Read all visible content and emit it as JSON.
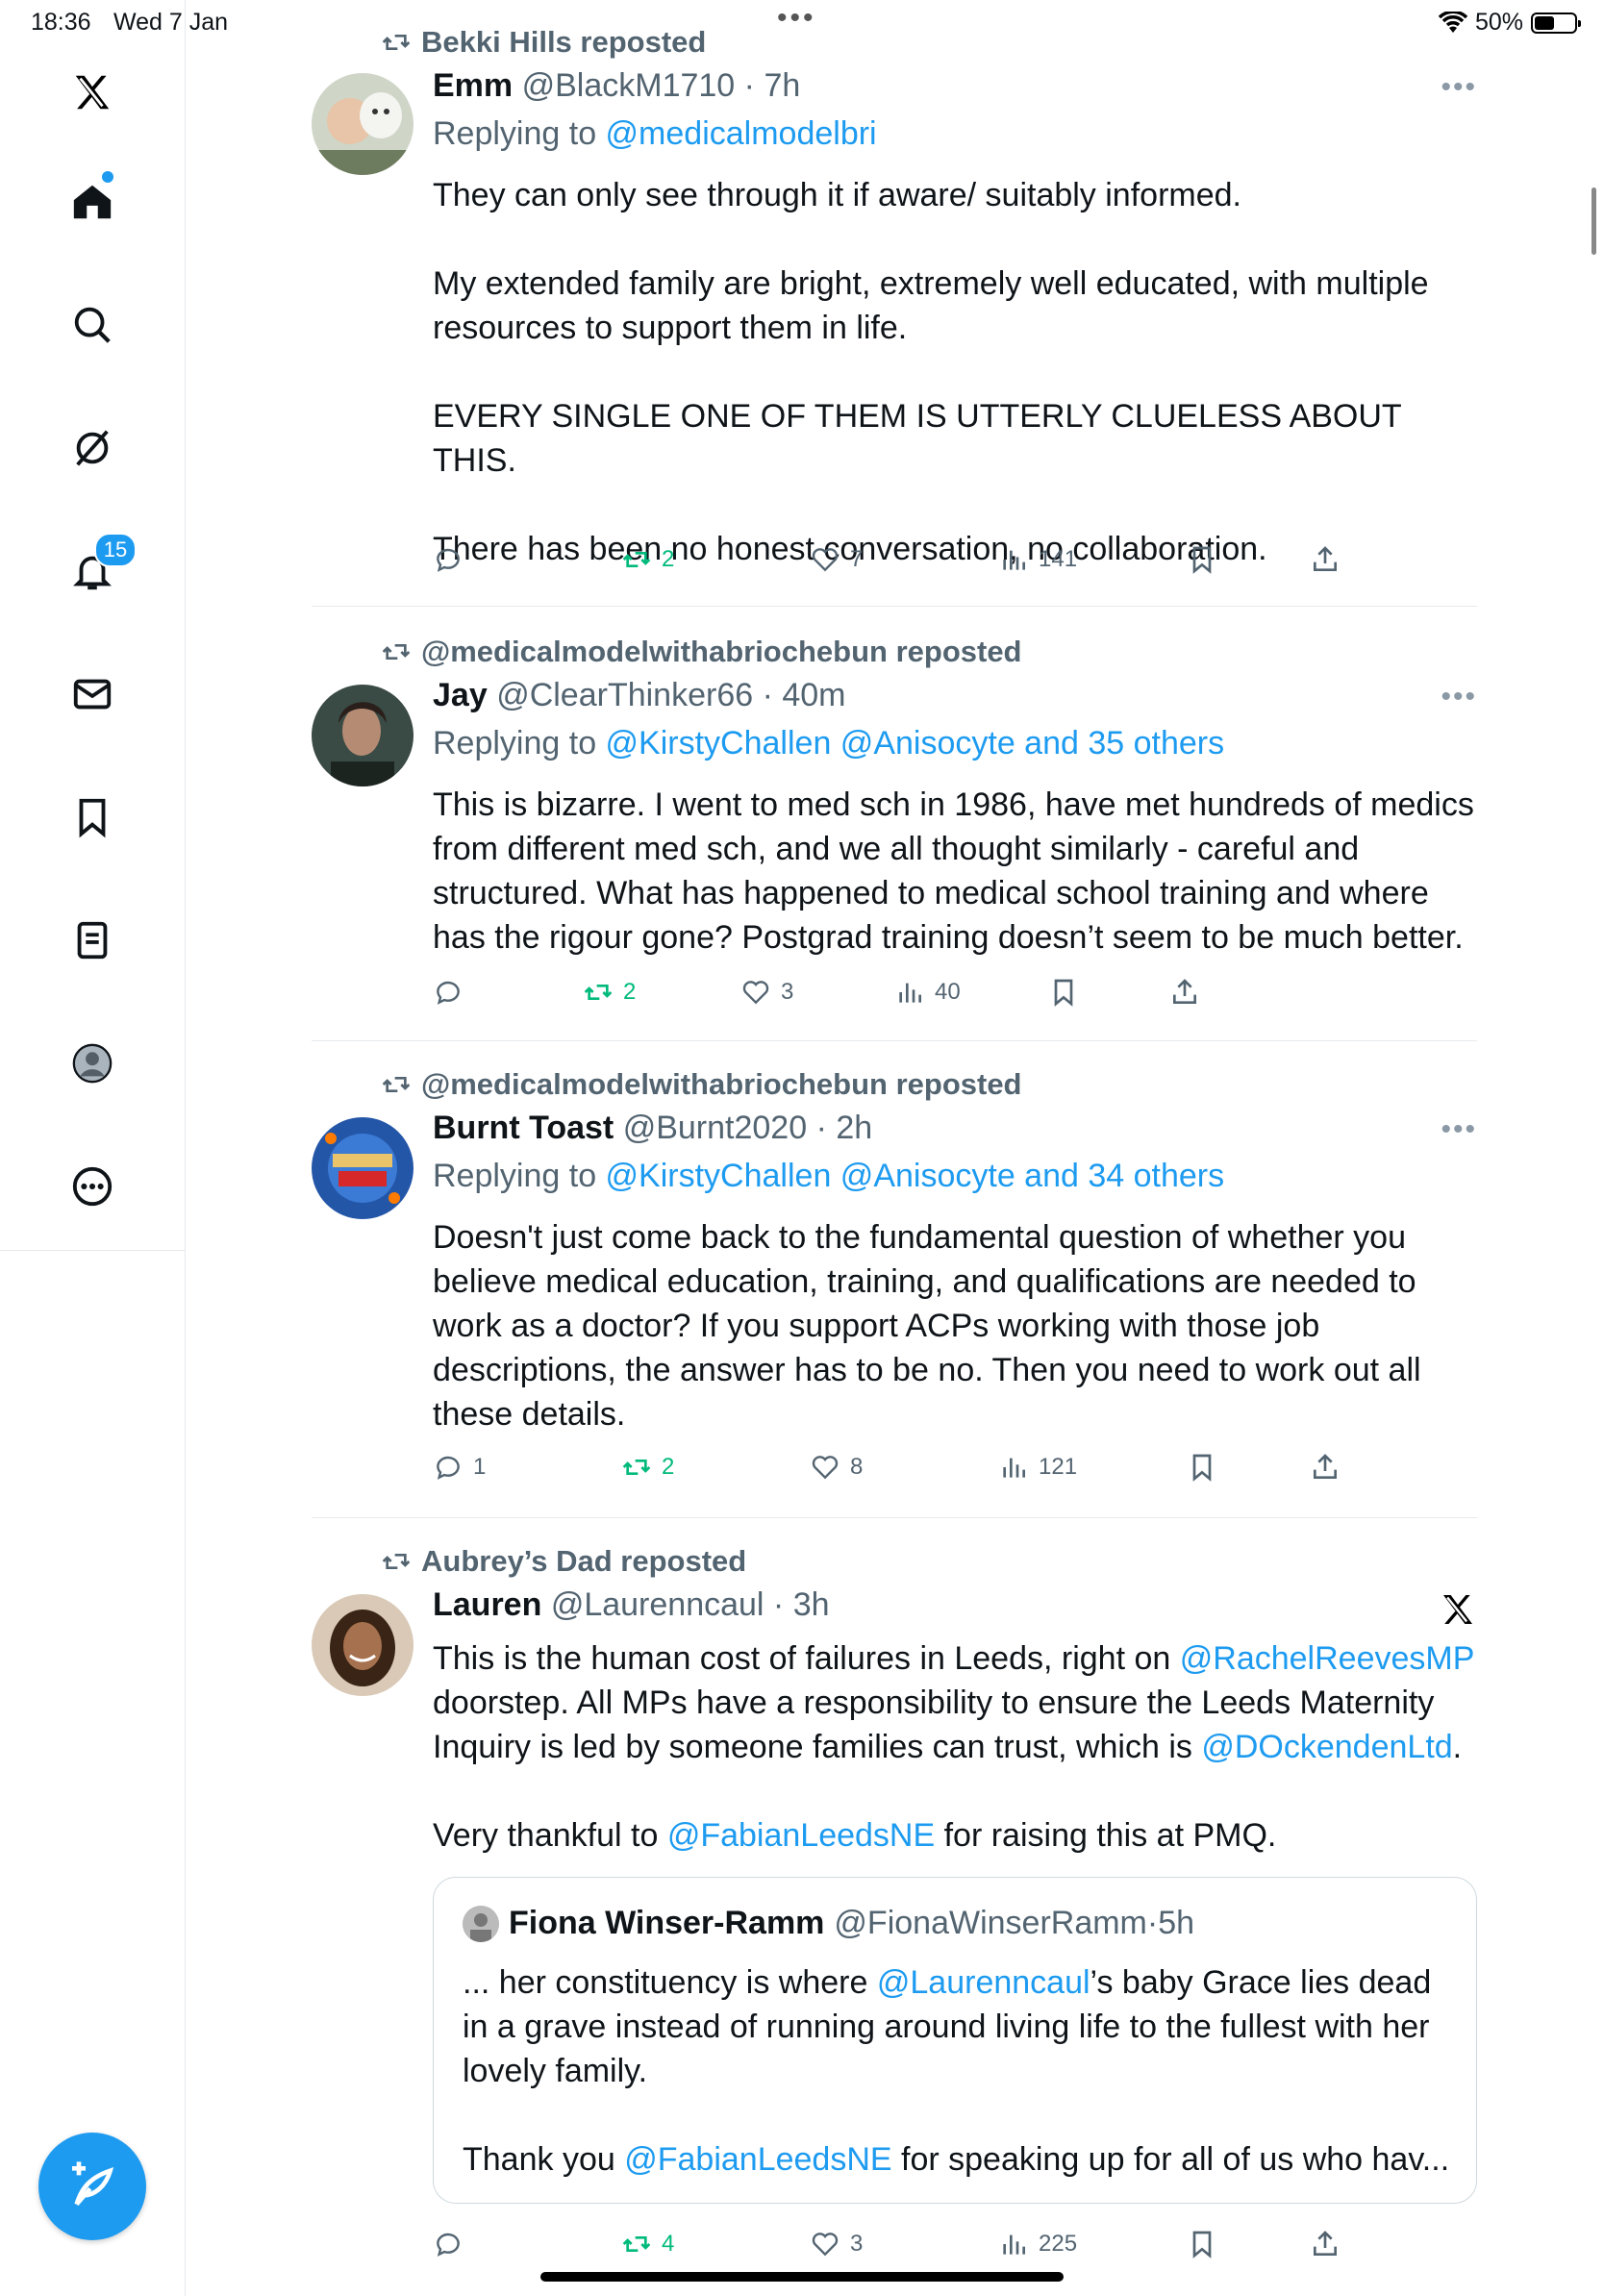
{
  "status": {
    "time": "18:36",
    "date": "Wed 7 Jan",
    "battery": "50%",
    "battery_level": 0.5
  },
  "sidebar": {
    "items": [
      {
        "name": "x-logo",
        "icon": "x-logo-icon"
      },
      {
        "name": "home",
        "icon": "home-icon"
      },
      {
        "name": "search",
        "icon": "search-icon"
      },
      {
        "name": "grok",
        "icon": "grok-icon"
      },
      {
        "name": "notifications",
        "icon": "bell-icon",
        "badge": "15"
      },
      {
        "name": "messages",
        "icon": "mail-icon"
      },
      {
        "name": "bookmarks",
        "icon": "bookmark-icon"
      },
      {
        "name": "lists",
        "icon": "list-icon"
      },
      {
        "name": "profile",
        "icon": "profile-icon"
      },
      {
        "name": "more",
        "icon": "more-circle-icon"
      }
    ]
  },
  "posts": [
    {
      "reposted_by": "Bekki Hills reposted",
      "name": "Emm",
      "handle": "@BlackM1710",
      "time": "7h",
      "reply_prefix": "Replying to ",
      "reply_targets": "@medicalmodelbri",
      "paragraphs": [
        "They can only see through it if aware/ suitably informed.",
        "My extended family are bright, extremely well educated, with multiple resources to support them in life.",
        "EVERY SINGLE ONE OF THEM IS UTTERLY CLUELESS ABOUT THIS.",
        "There has been no honest conversation, no collaboration."
      ],
      "replies": "",
      "reposts": "2",
      "likes": "7",
      "views": "141"
    },
    {
      "reposted_by": "@medicalmodelwithabriochebun reposted",
      "name": "Jay",
      "handle": "@ClearThinker66",
      "time": "40m",
      "reply_prefix": "Replying to ",
      "reply_targets": "@KirstyChallen @Anisocyte and 35 others",
      "paragraphs": [
        "This is bizarre. I went to med sch in 1986, have met hundreds of medics from different med sch, and we all thought similarly - careful and structured. What has happened to medical school training and where has the rigour gone? Postgrad training doesn’t seem to be much better."
      ],
      "replies": "",
      "reposts": "2",
      "likes": "3",
      "views": "40"
    },
    {
      "reposted_by": "@medicalmodelwithabriochebun reposted",
      "name": "Burnt Toast",
      "handle": "@Burnt2020",
      "time": "2h",
      "reply_prefix": "Replying to ",
      "reply_targets": "@KirstyChallen @Anisocyte and 34 others",
      "paragraphs": [
        "Doesn't just come back to the fundamental question of whether you believe medical education, training, and qualifications are needed to work as a doctor? If you support ACPs working with those job descriptions, the answer has to be no. Then you need to work out all these details."
      ],
      "replies": "1",
      "reposts": "2",
      "likes": "8",
      "views": "121"
    },
    {
      "reposted_by": "Aubrey’s Dad reposted",
      "name": "Lauren",
      "handle": "@Laurenncaul",
      "time": "3h",
      "p1_a": "This is the human cost of failures in Leeds, right on ",
      "p1_link1": "@RachelReevesMP",
      "p1_b": " doorstep. All MPs have a responsibility to ensure the Leeds Maternity Inquiry is led by someone families can trust, which is ",
      "p1_link2": "@DOckendenLtd",
      "p1_c": ".",
      "p2_a": "Very thankful to ",
      "p2_link": "@FabianLeedsNE",
      "p2_b": " for raising this at PMQ.",
      "quote": {
        "name": "Fiona Winser-Ramm",
        "handle": "@FionaWinserRamm",
        "time": "5h",
        "q1_a": "... her constituency is where ",
        "q1_link": "@Laurenncaul",
        "q1_b": "’s baby Grace lies dead in a grave instead of running around living life to the fullest with her lovely family.",
        "q2_a": "Thank you ",
        "q2_link": "@FabianLeedsNE",
        "q2_b": " for speaking up for all of us who hav..."
      },
      "replies": "",
      "reposts": "4",
      "likes": "3",
      "views": "225"
    }
  ]
}
